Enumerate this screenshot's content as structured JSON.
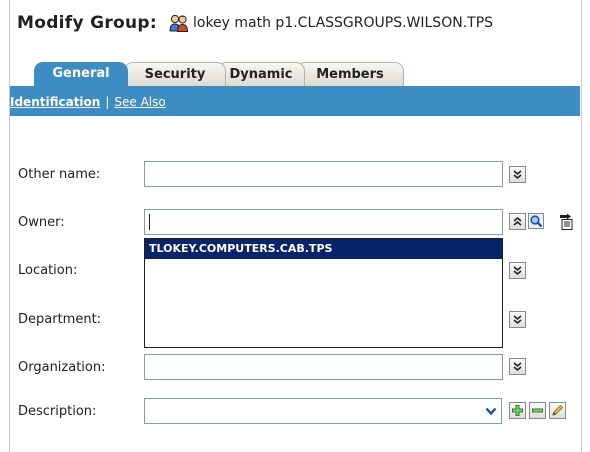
{
  "header": {
    "title": "Modify Group:",
    "object_name": "lokey math p1.CLASSGROUPS.WILSON.TPS",
    "icon": "group-icon"
  },
  "tabs": [
    {
      "label": "General",
      "active": true
    },
    {
      "label": "Security",
      "active": false
    },
    {
      "label": "Dynamic",
      "active": false
    },
    {
      "label": "Members",
      "active": false
    }
  ],
  "subnav": {
    "items": [
      {
        "label": "Identification",
        "active": true
      },
      {
        "label": "See Also",
        "active": false
      }
    ],
    "separator": "|"
  },
  "form": {
    "other_name": {
      "label": "Other name:",
      "value": "",
      "icons": [
        "expand-down-icon"
      ]
    },
    "owner": {
      "label": "Owner:",
      "value": "",
      "icons": [
        "collapse-up-icon",
        "search-icon",
        "history-icon"
      ]
    },
    "location": {
      "label": "Location:",
      "value": "",
      "icons": [
        "expand-down-icon"
      ]
    },
    "department": {
      "label": "Department:",
      "value": "",
      "icons": [
        "expand-down-icon"
      ]
    },
    "organization": {
      "label": "Organization:",
      "value": "",
      "icons": [
        "expand-down-icon"
      ]
    },
    "description": {
      "label": "Description:",
      "value": "",
      "icons": [
        "dropdown-arrow-icon",
        "add-icon",
        "remove-icon",
        "edit-icon"
      ]
    }
  },
  "owner_suggestions": [
    "TLOKEY.COMPUTERS.CAB.TPS"
  ],
  "colors": {
    "accent_blue": "#3d8dc4",
    "selection_navy": "#0a246a",
    "field_border": "#7f9db9",
    "add_green": "#2ea02e"
  }
}
